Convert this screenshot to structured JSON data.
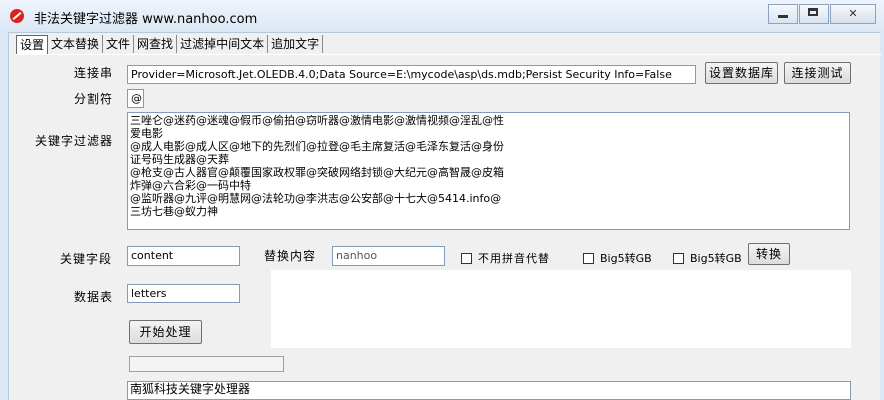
{
  "window": {
    "title": "非法关键字过滤器 www.nanhoo.com"
  },
  "tabs": [
    "设置",
    "文本替换",
    "文件",
    "网查找",
    "过滤掉中间文本",
    "追加文字"
  ],
  "connection": {
    "label": "连接串",
    "value": "Provider=Microsoft.Jet.OLEDB.4.0;Data Source=E:\\mycode\\asp\\ds.mdb;Persist Security Info=False",
    "set_button": "设置数据库",
    "test_button": "连接测试"
  },
  "separator": {
    "label": "分割符",
    "value": "@"
  },
  "keyword_filter": {
    "label": "关键字过滤器",
    "lines": [
      "三唑仑@迷药@迷魂@假币@偷拍@窃听器@激情电影@激情视频@淫乱@性",
      "爱电影",
      "@成人电影@成人区@地下的先烈们@拉登@毛主席复活@毛泽东复活@身份",
      "证号码生成器@天葬",
      "@枪支@古人器官@颠覆国家政权罪@突破网络封锁@大纪元@高智晟@皮箱",
      "炸弹@六合彩@一码中特",
      "@监听器@九评@明慧网@法轮功@李洪志@公安部@十七大@5414.info@",
      "三坊七巷@蚁力神"
    ]
  },
  "keyword_field": {
    "label": "关键字段",
    "value": "content"
  },
  "replace": {
    "label": "替换内容",
    "value": "nanhoo"
  },
  "options": {
    "no_pinyin": "不用拼音代替",
    "big5_gb_1": "Big5转GB",
    "big5_gb_2": "Big5转GB",
    "convert_button": "转换"
  },
  "table": {
    "label": "数据表",
    "value": "letters"
  },
  "start_button": "开始处理",
  "progress": 0,
  "output": {
    "text": "南狐科技关键字处理器"
  }
}
